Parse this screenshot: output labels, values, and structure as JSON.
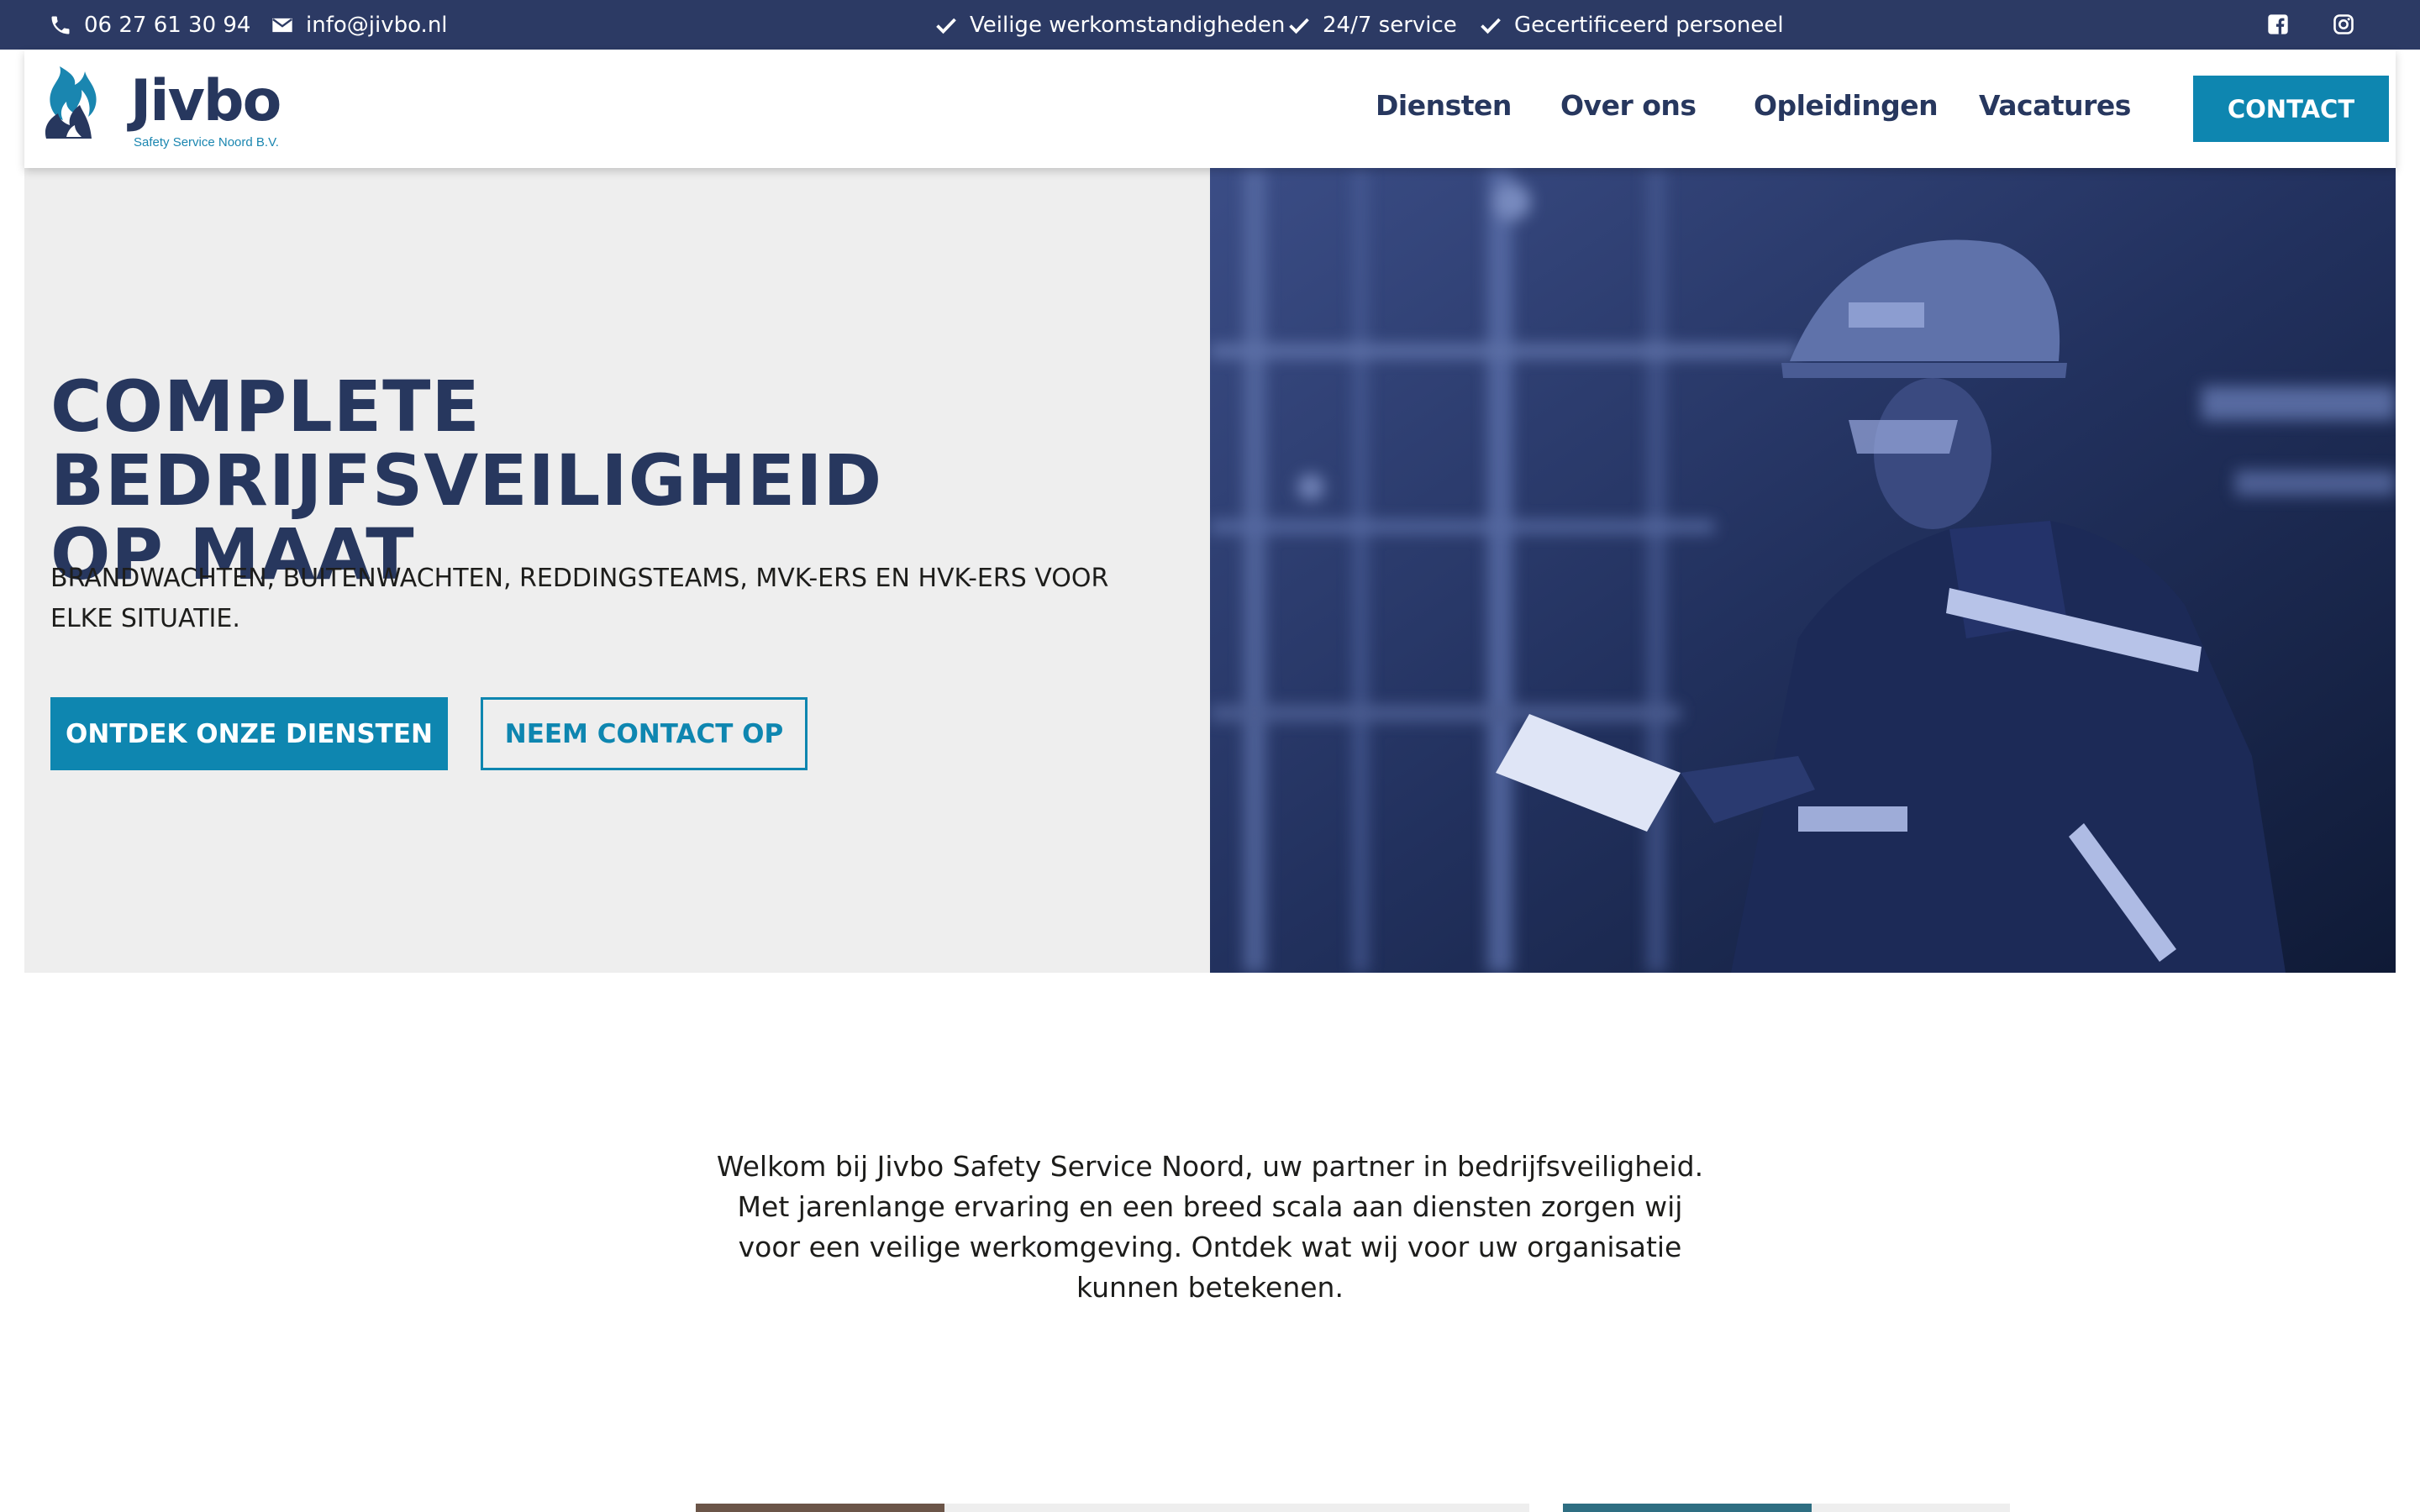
{
  "topbar": {
    "phone": "06 27 61 30 94",
    "email": "info@jivbo.nl",
    "usps": [
      "Veilige werkomstandigheden",
      "24/7 service",
      "Gecertificeerd personeel"
    ],
    "social": [
      "facebook-icon",
      "instagram-icon"
    ]
  },
  "header": {
    "logo_text": "Jivbo",
    "logo_subtitle": "Safety Service Noord B.V.",
    "nav": [
      "Diensten",
      "Over ons",
      "Opleidingen",
      "Vacatures"
    ],
    "contact_label": "CONTACT"
  },
  "hero": {
    "title_line1": "COMPLETE BEDRIJFSVEILIGHEID",
    "title_line2": "OP MAAT",
    "subtitle": "BRANDWACHTEN, BUITENWACHTEN, REDDINGSTEAMS, MVK-ERS EN HVK-ERS VOOR ELKE SITUATIE.",
    "primary_button": "ONTDEK ONZE DIENSTEN",
    "secondary_button": "NEEM CONTACT OP"
  },
  "intro": {
    "text": "Welkom bij Jivbo Safety Service Noord, uw partner in bedrijfsveiligheid. Met jarenlange ervaring en een breed scala aan diensten zorgen wij voor een veilige werkomgeving. Ontdek wat wij voor uw organisatie kunnen betekenen."
  },
  "colors": {
    "navy": "#27375e",
    "topbar": "#2c3a64",
    "accent": "#0e86b0",
    "hero_bg": "#eeeeee"
  }
}
